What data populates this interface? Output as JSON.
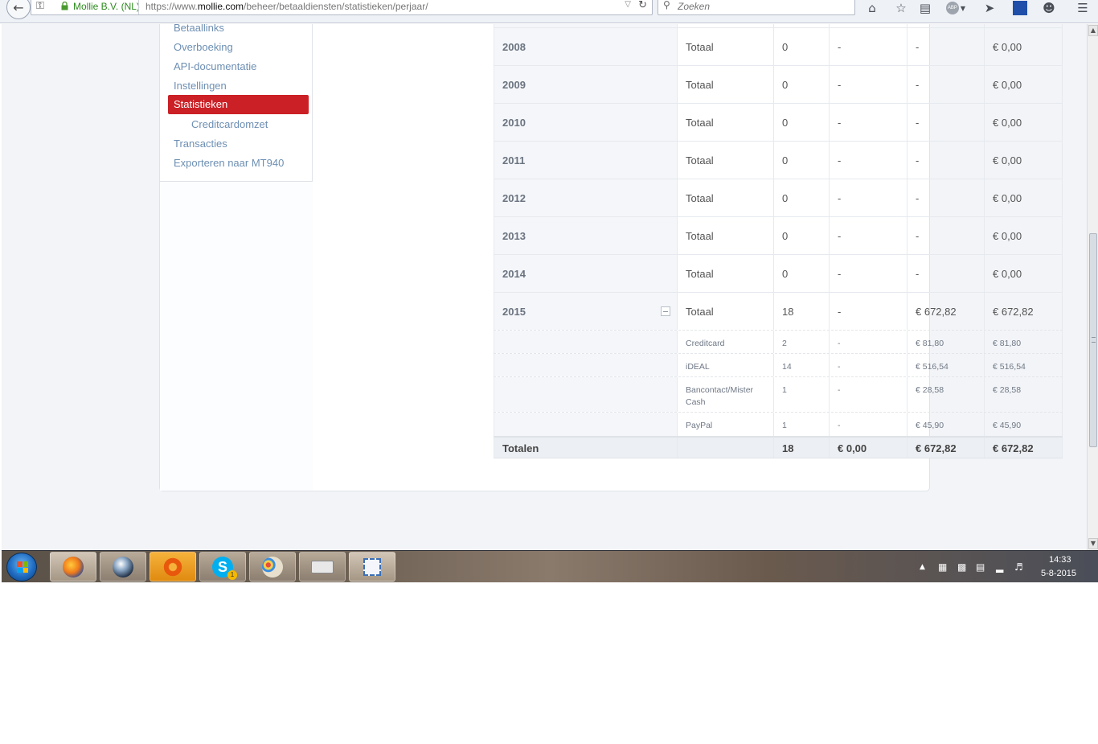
{
  "browser": {
    "identity": "Mollie B.V. (NL)",
    "url_prefix": "https://www.",
    "url_domain": "mollie.com",
    "url_path": "/beheer/betaaldiensten/statistieken/perjaar/",
    "search_placeholder": "Zoeken"
  },
  "sidebar": {
    "items": [
      {
        "label": "Betaallinks"
      },
      {
        "label": "Overboeking"
      },
      {
        "label": "API-documentatie"
      },
      {
        "label": "Instellingen"
      },
      {
        "label": "Statistieken",
        "active": true
      },
      {
        "label": "Creditcardomzet",
        "sub": true
      },
      {
        "label": "Transacties"
      },
      {
        "label": "Exporteren naar MT940"
      }
    ],
    "active_color": "#cb2026"
  },
  "table": {
    "rows": [
      {
        "year": "2008",
        "type": "Totaal",
        "count": "0",
        "col3": "-",
        "col4": "-",
        "total": "€ 0,00"
      },
      {
        "year": "2009",
        "type": "Totaal",
        "count": "0",
        "col3": "-",
        "col4": "-",
        "total": "€ 0,00"
      },
      {
        "year": "2010",
        "type": "Totaal",
        "count": "0",
        "col3": "-",
        "col4": "-",
        "total": "€ 0,00"
      },
      {
        "year": "2011",
        "type": "Totaal",
        "count": "0",
        "col3": "-",
        "col4": "-",
        "total": "€ 0,00"
      },
      {
        "year": "2012",
        "type": "Totaal",
        "count": "0",
        "col3": "-",
        "col4": "-",
        "total": "€ 0,00"
      },
      {
        "year": "2013",
        "type": "Totaal",
        "count": "0",
        "col3": "-",
        "col4": "-",
        "total": "€ 0,00"
      },
      {
        "year": "2014",
        "type": "Totaal",
        "count": "0",
        "col3": "-",
        "col4": "-",
        "total": "€ 0,00"
      },
      {
        "year": "2015",
        "type": "Totaal",
        "count": "18",
        "col3": "-",
        "col4": "€ 672,82",
        "total": "€ 672,82"
      }
    ],
    "sub_rows": [
      {
        "method": "Creditcard",
        "count": "2",
        "col3": "-",
        "col4": "€ 81,80",
        "total": "€ 81,80"
      },
      {
        "method": "iDEAL",
        "count": "14",
        "col3": "-",
        "col4": "€ 516,54",
        "total": "€ 516,54"
      },
      {
        "method_line1": "Bancontact/Mister",
        "method_line2": "Cash",
        "count": "1",
        "col3": "-",
        "col4": "€ 28,58",
        "total": "€ 28,58"
      },
      {
        "method": "PayPal",
        "count": "1",
        "col3": "-",
        "col4": "€ 45,90",
        "total": "€ 45,90"
      }
    ],
    "totals": {
      "label": "Totalen",
      "count": "18",
      "col3": "€ 0,00",
      "col4": "€ 672,82",
      "total": "€ 672,82"
    }
  },
  "taskbar": {
    "time": "14:33",
    "date": "5-8-2015",
    "skype_badge": "1"
  },
  "icons": {
    "back": "arrow-left-icon",
    "key": "key-icon",
    "lock": "lock-icon",
    "reload": "reload-icon",
    "home": "home-icon",
    "bookmark": "star-icon",
    "reader": "reading-list-icon",
    "adblock": "adblock-icon",
    "send": "send-icon",
    "addon": "grid-icon",
    "chat": "chat-icon",
    "menu": "hamburger-menu-icon"
  }
}
